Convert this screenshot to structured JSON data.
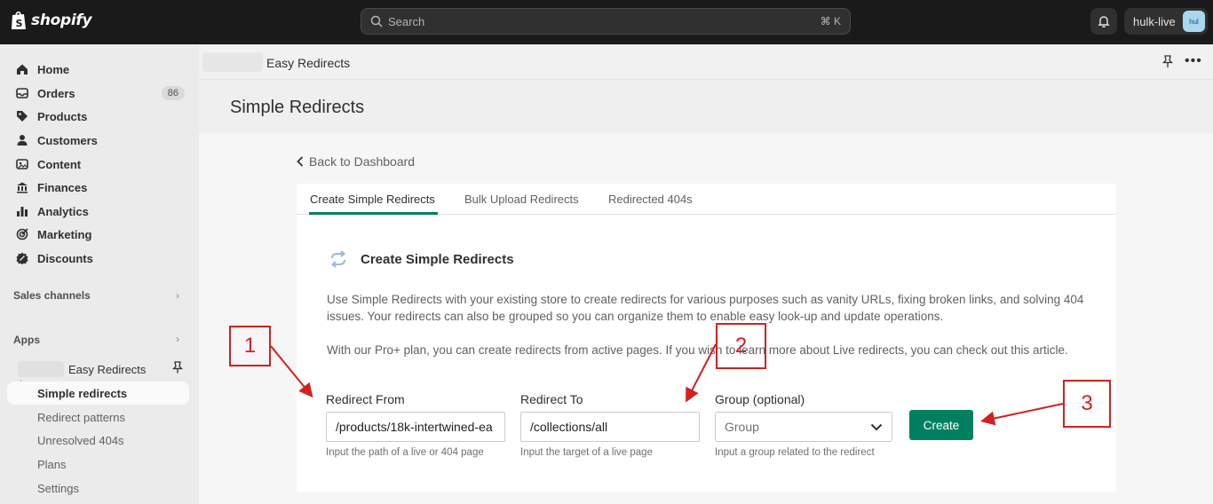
{
  "topbar": {
    "logo_text": "shopify",
    "search_placeholder": "Search",
    "search_shortcut": "⌘ K",
    "store_name": "hulk-live",
    "store_avatar": "hul"
  },
  "sidebar": {
    "items": [
      {
        "label": "Home",
        "icon": "home-icon"
      },
      {
        "label": "Orders",
        "icon": "orders-icon",
        "badge": "86"
      },
      {
        "label": "Products",
        "icon": "tag-icon"
      },
      {
        "label": "Customers",
        "icon": "person-icon"
      },
      {
        "label": "Content",
        "icon": "content-icon"
      },
      {
        "label": "Finances",
        "icon": "bank-icon"
      },
      {
        "label": "Analytics",
        "icon": "chart-icon"
      },
      {
        "label": "Marketing",
        "icon": "target-icon"
      },
      {
        "label": "Discounts",
        "icon": "discount-icon"
      }
    ],
    "sales_channels_label": "Sales channels",
    "apps_label": "Apps",
    "app_name": "Easy Redirects",
    "app_subitems": [
      "Simple redirects",
      "Redirect patterns",
      "Unresolved 404s",
      "Plans",
      "Settings"
    ]
  },
  "appbar": {
    "title": "Easy Redirects"
  },
  "page": {
    "title": "Simple Redirects",
    "back_label": "Back to Dashboard",
    "tabs": [
      "Create Simple Redirects",
      "Bulk Upload Redirects",
      "Redirected 404s"
    ],
    "section_title": "Create Simple Redirects",
    "para1": "Use Simple Redirects with your existing store to create redirects for various purposes such as vanity URLs, fixing broken links, and solving 404 issues. Your redirects can also be grouped so you can organize them to enable easy look-up and update operations.",
    "para2": "With our Pro+ plan, you can create redirects from active pages. If you wish to learn more about Live redirects, you can check out this article.",
    "from": {
      "label": "Redirect From",
      "value": "/products/18k-intertwined-ea",
      "hint": "Input the path of a live or 404 page"
    },
    "to": {
      "label": "Redirect To",
      "value": "/collections/all",
      "hint": "Input the target of a live page"
    },
    "group": {
      "label": "Group (optional)",
      "placeholder": "Group",
      "hint": "Input a group related to the redirect"
    },
    "create_label": "Create"
  },
  "annotations": [
    "1",
    "2",
    "3"
  ],
  "colors": {
    "primary": "#008060",
    "annotation": "#d42020",
    "topbar": "#1a1a1a"
  }
}
